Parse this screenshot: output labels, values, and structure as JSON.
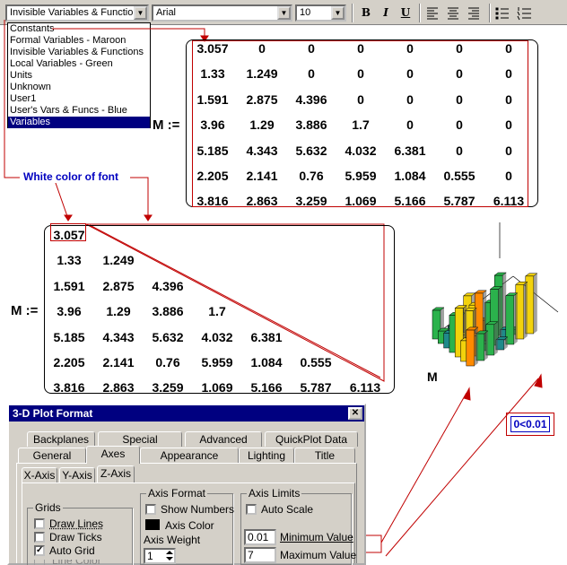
{
  "toolbar": {
    "style_value": "Invisible Variables & Function",
    "font_value": "Arial",
    "size_value": "10",
    "bold": "B",
    "italic": "I",
    "underline": "U"
  },
  "style_list": {
    "items": [
      {
        "label": "Constants"
      },
      {
        "label": "Formal Variables - Maroon"
      },
      {
        "label": "Invisible Variables & Functions"
      },
      {
        "label": "Local Variables - Green"
      },
      {
        "label": "Units"
      },
      {
        "label": "Unknown"
      },
      {
        "label": "User1"
      },
      {
        "label": "User's Vars & Funcs - Blue"
      },
      {
        "label": "Variables"
      }
    ]
  },
  "annotation": {
    "white_font": "White color of font",
    "range": "0<0.01"
  },
  "matrix_full": {
    "label": "M :=",
    "rows": [
      [
        "3.057",
        "0",
        "0",
        "0",
        "0",
        "0",
        "0"
      ],
      [
        "1.33",
        "1.249",
        "0",
        "0",
        "0",
        "0",
        "0"
      ],
      [
        "1.591",
        "2.875",
        "4.396",
        "0",
        "0",
        "0",
        "0"
      ],
      [
        "3.96",
        "1.29",
        "3.886",
        "1.7",
        "0",
        "0",
        "0"
      ],
      [
        "5.185",
        "4.343",
        "5.632",
        "4.032",
        "6.381",
        "0",
        "0"
      ],
      [
        "2.205",
        "2.141",
        "0.76",
        "5.959",
        "1.084",
        "0.555",
        "0"
      ],
      [
        "3.816",
        "2.863",
        "3.259",
        "1.069",
        "5.166",
        "5.787",
        "6.113"
      ]
    ]
  },
  "matrix_lower": {
    "label": "M :=",
    "rows": [
      [
        "3.057"
      ],
      [
        "1.33",
        "1.249"
      ],
      [
        "1.591",
        "2.875",
        "4.396"
      ],
      [
        "3.96",
        "1.29",
        "3.886",
        "1.7"
      ],
      [
        "5.185",
        "4.343",
        "5.632",
        "4.032",
        "6.381"
      ],
      [
        "2.205",
        "2.141",
        "0.76",
        "5.959",
        "1.084",
        "0.555"
      ],
      [
        "3.816",
        "2.863",
        "3.259",
        "1.069",
        "5.166",
        "5.787",
        "6.113"
      ]
    ]
  },
  "plot": {
    "label": "M",
    "colors": {
      "green": "#2bb24c",
      "yellow": "#f2d20c",
      "orange": "#ff8a00",
      "navy": "#1a237e",
      "teal": "#1f8a8a"
    }
  },
  "dialog": {
    "title": "3-D Plot Format",
    "close": "✕",
    "tabs_back": [
      "Backplanes",
      "Special",
      "Advanced",
      "QuickPlot Data"
    ],
    "tabs_front": [
      "General",
      "Axes",
      "Appearance",
      "Lighting",
      "Title"
    ],
    "subtabs": [
      "X-Axis",
      "Y-Axis",
      "Z-Axis"
    ],
    "grids_label": "Grids",
    "draw_lines": "Draw Lines",
    "draw_ticks": "Draw Ticks",
    "auto_grid": "Auto Grid",
    "line_color": "Line Color",
    "axis_format_label": "Axis Format",
    "show_numbers": "Show Numbers",
    "axis_color": "Axis Color",
    "axis_weight": "Axis Weight",
    "axis_weight_value": "1",
    "axis_limits_label": "Axis Limits",
    "auto_scale": "Auto Scale",
    "min_value": "0.01",
    "min_label": "Minimum Value",
    "max_value": "7",
    "max_label": "Maximum Value"
  }
}
